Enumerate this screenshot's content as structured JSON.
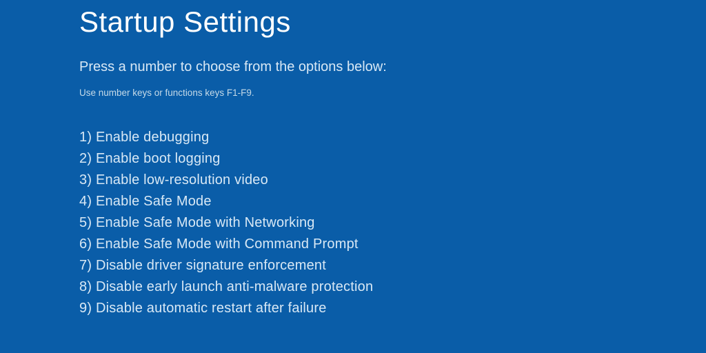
{
  "title": "Startup Settings",
  "instruction": "Press a number to choose from the options below:",
  "hint": "Use number keys or functions keys F1-F9.",
  "options": [
    "1) Enable debugging",
    "2) Enable boot logging",
    "3) Enable low-resolution video",
    "4) Enable Safe Mode",
    "5) Enable Safe Mode with Networking",
    "6) Enable Safe Mode with Command Prompt",
    "7) Disable driver signature enforcement",
    "8) Disable early launch anti-malware protection",
    "9) Disable automatic restart after failure"
  ]
}
